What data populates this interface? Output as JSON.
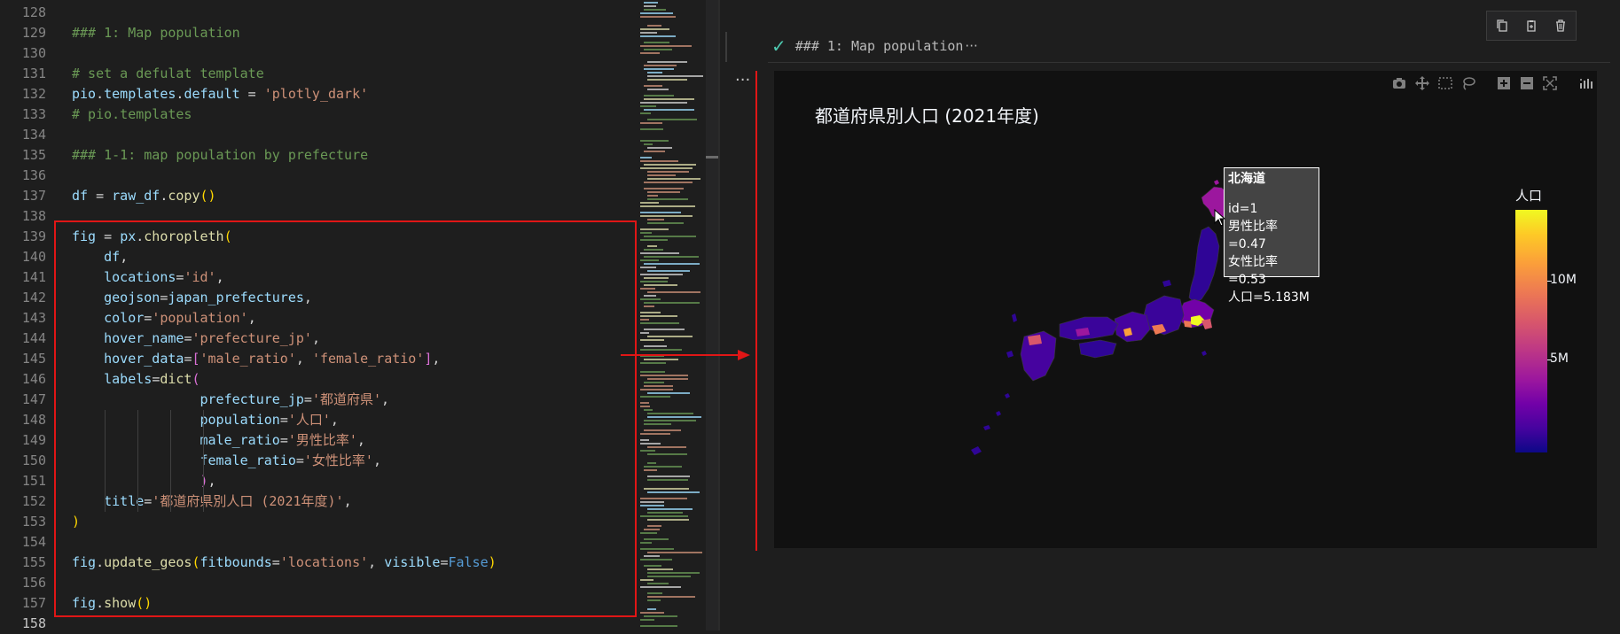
{
  "editor": {
    "lines": [
      {
        "num": "128"
      },
      {
        "num": "129",
        "tokens": [
          {
            "t": "### 1: Map population",
            "c": "k-cm"
          }
        ]
      },
      {
        "num": "130"
      },
      {
        "num": "131",
        "tokens": [
          {
            "t": "# set a defulat template",
            "c": "k-cm"
          }
        ]
      },
      {
        "num": "132",
        "tokens": [
          {
            "t": "pio",
            "c": "k-var"
          },
          {
            "t": ".",
            "c": "k-op"
          },
          {
            "t": "templates",
            "c": "k-var"
          },
          {
            "t": ".",
            "c": "k-op"
          },
          {
            "t": "default",
            "c": "k-var"
          },
          {
            "t": " = ",
            "c": "k-op"
          },
          {
            "t": "'plotly_dark'",
            "c": "k-str"
          }
        ]
      },
      {
        "num": "133",
        "tokens": [
          {
            "t": "# pio.templates",
            "c": "k-cm"
          }
        ]
      },
      {
        "num": "134"
      },
      {
        "num": "135",
        "tokens": [
          {
            "t": "### 1-1: map population by prefecture",
            "c": "k-cm"
          }
        ]
      },
      {
        "num": "136"
      },
      {
        "num": "137",
        "tokens": [
          {
            "t": "df",
            "c": "k-var"
          },
          {
            "t": " = ",
            "c": "k-op"
          },
          {
            "t": "raw_df",
            "c": "k-var"
          },
          {
            "t": ".",
            "c": "k-op"
          },
          {
            "t": "copy",
            "c": "k-fn"
          },
          {
            "t": "()",
            "c": "k-br"
          }
        ]
      },
      {
        "num": "138"
      },
      {
        "num": "139",
        "tokens": [
          {
            "t": "fig",
            "c": "k-var"
          },
          {
            "t": " = ",
            "c": "k-op"
          },
          {
            "t": "px",
            "c": "k-var"
          },
          {
            "t": ".",
            "c": "k-op"
          },
          {
            "t": "choropleth",
            "c": "k-fn"
          },
          {
            "t": "(",
            "c": "k-br"
          }
        ]
      },
      {
        "num": "140",
        "tokens": [
          {
            "t": "    df",
            "c": "k-var"
          },
          {
            "t": ",",
            "c": "k-op"
          }
        ]
      },
      {
        "num": "141",
        "tokens": [
          {
            "t": "    locations",
            "c": "k-var"
          },
          {
            "t": "=",
            "c": "k-op"
          },
          {
            "t": "'id'",
            "c": "k-str"
          },
          {
            "t": ",",
            "c": "k-op"
          }
        ]
      },
      {
        "num": "142",
        "tokens": [
          {
            "t": "    geojson",
            "c": "k-var"
          },
          {
            "t": "=",
            "c": "k-op"
          },
          {
            "t": "japan_prefectures",
            "c": "k-var"
          },
          {
            "t": ",",
            "c": "k-op"
          }
        ]
      },
      {
        "num": "143",
        "tokens": [
          {
            "t": "    color",
            "c": "k-var"
          },
          {
            "t": "=",
            "c": "k-op"
          },
          {
            "t": "'population'",
            "c": "k-str"
          },
          {
            "t": ",",
            "c": "k-op"
          }
        ]
      },
      {
        "num": "144",
        "tokens": [
          {
            "t": "    hover_name",
            "c": "k-var"
          },
          {
            "t": "=",
            "c": "k-op"
          },
          {
            "t": "'prefecture_jp'",
            "c": "k-str"
          },
          {
            "t": ",",
            "c": "k-op"
          }
        ]
      },
      {
        "num": "145",
        "tokens": [
          {
            "t": "    hover_data",
            "c": "k-var"
          },
          {
            "t": "=",
            "c": "k-op"
          },
          {
            "t": "[",
            "c": "k-br2"
          },
          {
            "t": "'male_ratio'",
            "c": "k-str"
          },
          {
            "t": ", ",
            "c": "k-op"
          },
          {
            "t": "'female_ratio'",
            "c": "k-str"
          },
          {
            "t": "]",
            "c": "k-br2"
          },
          {
            "t": ",",
            "c": "k-op"
          }
        ]
      },
      {
        "num": "146",
        "tokens": [
          {
            "t": "    labels",
            "c": "k-var"
          },
          {
            "t": "=",
            "c": "k-op"
          },
          {
            "t": "dict",
            "c": "k-fn"
          },
          {
            "t": "(",
            "c": "k-br2"
          }
        ]
      },
      {
        "num": "147",
        "tokens": [
          {
            "t": "                prefecture_jp",
            "c": "k-var"
          },
          {
            "t": "=",
            "c": "k-op"
          },
          {
            "t": "'都道府県'",
            "c": "k-str"
          },
          {
            "t": ",",
            "c": "k-op"
          }
        ]
      },
      {
        "num": "148",
        "tokens": [
          {
            "t": "                population",
            "c": "k-var"
          },
          {
            "t": "=",
            "c": "k-op"
          },
          {
            "t": "'人口'",
            "c": "k-str"
          },
          {
            "t": ",",
            "c": "k-op"
          }
        ]
      },
      {
        "num": "149",
        "tokens": [
          {
            "t": "                male_ratio",
            "c": "k-var"
          },
          {
            "t": "=",
            "c": "k-op"
          },
          {
            "t": "'男性比率'",
            "c": "k-str"
          },
          {
            "t": ",",
            "c": "k-op"
          }
        ]
      },
      {
        "num": "150",
        "tokens": [
          {
            "t": "                female_ratio",
            "c": "k-var"
          },
          {
            "t": "=",
            "c": "k-op"
          },
          {
            "t": "'女性比率'",
            "c": "k-str"
          },
          {
            "t": ",",
            "c": "k-op"
          }
        ]
      },
      {
        "num": "151",
        "tokens": [
          {
            "t": "                ",
            "c": "k-op"
          },
          {
            "t": ")",
            "c": "k-br2"
          },
          {
            "t": ",",
            "c": "k-op"
          }
        ]
      },
      {
        "num": "152",
        "tokens": [
          {
            "t": "    title",
            "c": "k-var"
          },
          {
            "t": "=",
            "c": "k-op"
          },
          {
            "t": "'都道府県別人口 (2021年度)'",
            "c": "k-str"
          },
          {
            "t": ",",
            "c": "k-op"
          }
        ]
      },
      {
        "num": "153",
        "tokens": [
          {
            "t": ")",
            "c": "k-br"
          }
        ]
      },
      {
        "num": "154"
      },
      {
        "num": "155",
        "tokens": [
          {
            "t": "fig",
            "c": "k-var"
          },
          {
            "t": ".",
            "c": "k-op"
          },
          {
            "t": "update_geos",
            "c": "k-fn"
          },
          {
            "t": "(",
            "c": "k-br"
          },
          {
            "t": "fitbounds",
            "c": "k-var"
          },
          {
            "t": "=",
            "c": "k-op"
          },
          {
            "t": "'locations'",
            "c": "k-str"
          },
          {
            "t": ", ",
            "c": "k-op"
          },
          {
            "t": "visible",
            "c": "k-var"
          },
          {
            "t": "=",
            "c": "k-op"
          },
          {
            "t": "False",
            "c": "k-kw"
          },
          {
            "t": ")",
            "c": "k-br"
          }
        ]
      },
      {
        "num": "156"
      },
      {
        "num": "157",
        "tokens": [
          {
            "t": "fig",
            "c": "k-var"
          },
          {
            "t": ".",
            "c": "k-op"
          },
          {
            "t": "show",
            "c": "k-fn"
          },
          {
            "t": "()",
            "c": "k-br"
          }
        ]
      },
      {
        "num": "158",
        "active": true
      }
    ]
  },
  "cell": {
    "header_title": "### 1: Map population",
    "header_ellipsis": "···",
    "output_menu": "···",
    "toolbar": [
      "copy-icon",
      "paste-icon",
      "delete-icon"
    ]
  },
  "modebar": [
    "camera-icon",
    "pan-icon",
    "box-select-icon",
    "lasso-icon",
    "zoom-in-icon",
    "zoom-out-icon",
    "reset-view-icon",
    "plotly-logo-icon"
  ],
  "chart_data": {
    "type": "choropleth",
    "title": "都道府県別人口 (2021年度)",
    "colorbar": {
      "title": "人口",
      "ticks": [
        "10M",
        "5M"
      ],
      "colorscale": [
        "#0d0887",
        "#46039f",
        "#7201a8",
        "#9c179e",
        "#bd3786",
        "#d8576b",
        "#ed7953",
        "#fb9f3a",
        "#fdca26",
        "#f0f921"
      ]
    },
    "hover": {
      "name": "北海道",
      "lines": [
        "id=1",
        "男性比率=0.47",
        "女性比率=0.53",
        "人口=5.183M"
      ]
    }
  }
}
